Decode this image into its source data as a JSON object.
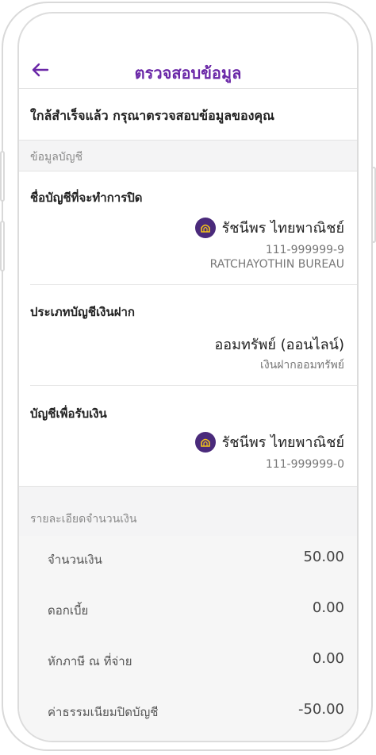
{
  "header": {
    "title": "ตรวจสอบข้อมูล"
  },
  "subtitle": "ใกล้สำเร็จแล้ว กรุณาตรวจสอบข้อมูลของคุณ",
  "account_section": {
    "heading": "ข้อมูลบัญชี",
    "close_account": {
      "label": "ชื่อบัญชีที่จะทำการปิด",
      "name": "รัชนีพร ไทยพาณิชย์",
      "number": "111-999999-9",
      "branch": "RATCHAYOTHIN BUREAU"
    },
    "account_type": {
      "label": "ประเภทบัญชีเงินฝาก",
      "type": "ออมทรัพย์ (ออนไลน์)",
      "subtype": "เงินฝากออมทรัพย์"
    },
    "receive_account": {
      "label": "บัญชีเพื่อรับเงิน",
      "name": "รัชนีพร ไทยพาณิชย์",
      "number": "111-999999-0"
    }
  },
  "amount_section": {
    "heading": "รายละเอียดจำนวนเงิน",
    "rows": [
      {
        "label": "จำนวนเงิน",
        "value": "50.00"
      },
      {
        "label": "ดอกเบี้ย",
        "value": "0.00"
      },
      {
        "label": "หักภาษี ณ ที่จ่าย",
        "value": "0.00"
      },
      {
        "label": "ค่าธรรมเนียมปิดบัญชี",
        "value": "-50.00"
      }
    ]
  },
  "colors": {
    "accent": "#6a27a7",
    "bank_logo": "#4a2a7b",
    "bank_logo_mark": "#f5c518"
  },
  "icons": {
    "back": "arrow-left-icon",
    "bank": "scb-bank-logo-icon"
  }
}
